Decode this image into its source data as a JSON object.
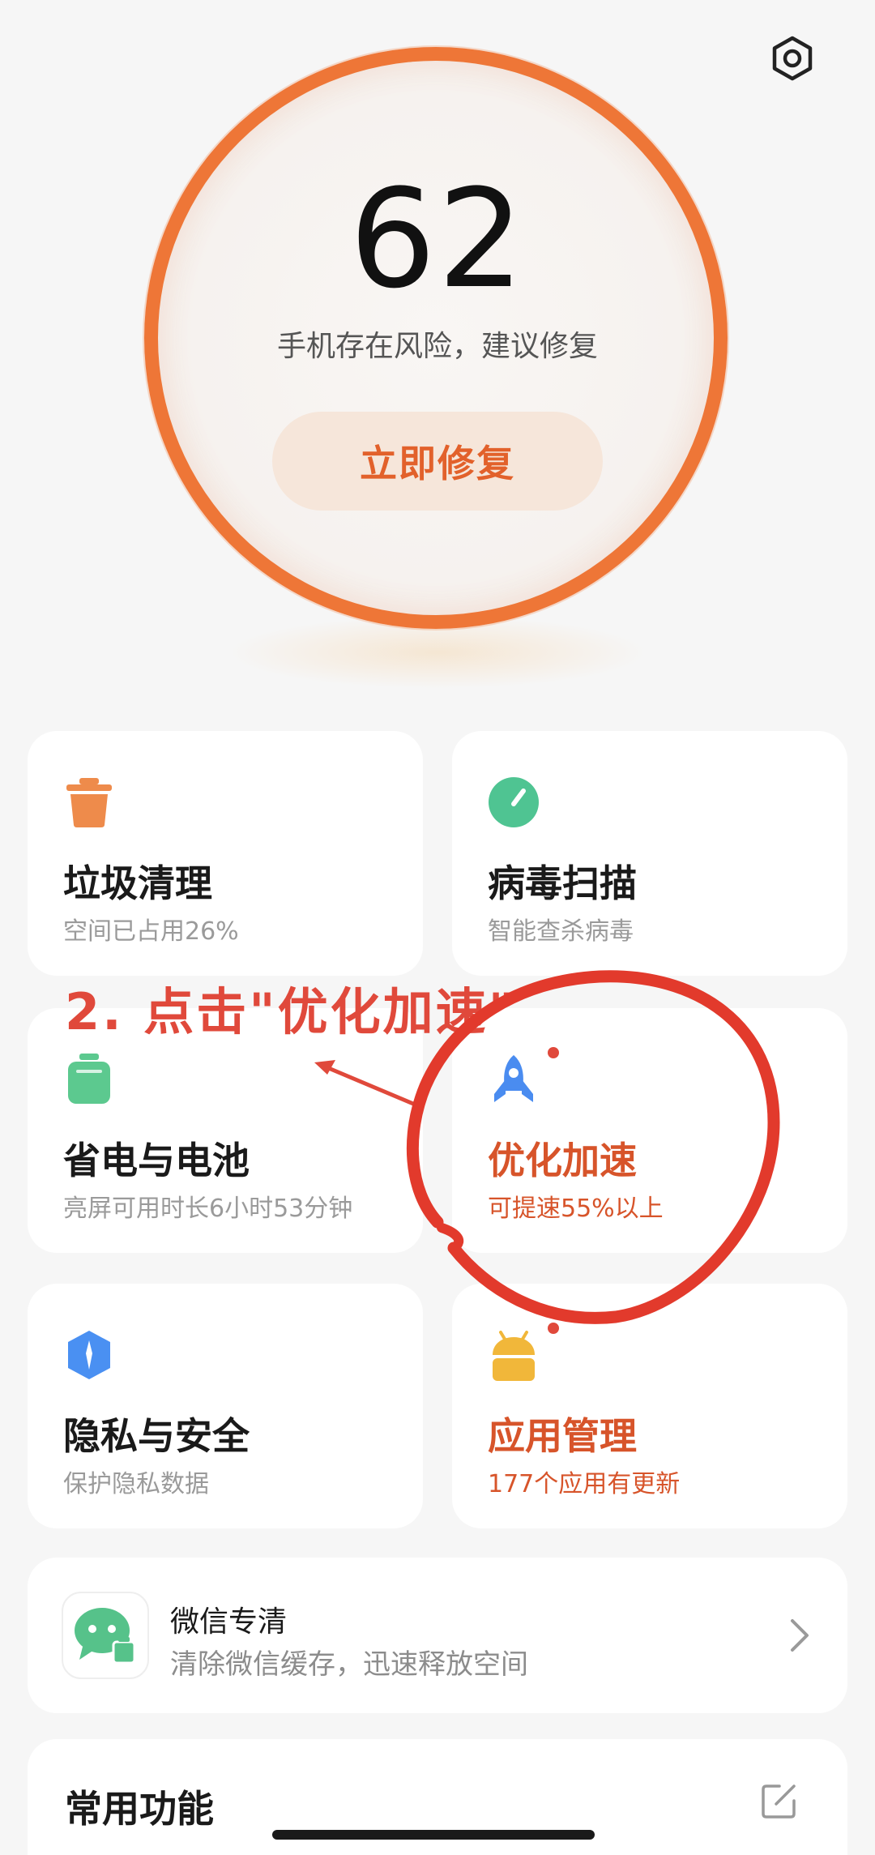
{
  "score": {
    "value": "62",
    "message": "手机存在风险，建议修复",
    "fix_label": "立即修复",
    "ring_color": "#ee7637"
  },
  "header": {
    "settings_icon": "settings-hex-icon"
  },
  "cards": [
    {
      "title": "垃圾清理",
      "subtitle": "空间已占用26%",
      "icon": "trash-icon",
      "color": "#ee8b4b"
    },
    {
      "title": "病毒扫描",
      "subtitle": "智能查杀病毒",
      "icon": "virus-scan-icon",
      "color": "#4fc492"
    },
    {
      "title": "省电与电池",
      "subtitle": "亮屏可用时长6小时53分钟",
      "icon": "battery-icon",
      "color": "#5cc98f"
    },
    {
      "title": "优化加速",
      "subtitle": "可提速55%以上",
      "icon": "rocket-icon",
      "color": "#4a8cf0",
      "alert": true
    },
    {
      "title": "隐私与安全",
      "subtitle": "保护隐私数据",
      "icon": "shield-privacy-icon",
      "color": "#4a90f2"
    },
    {
      "title": "应用管理",
      "subtitle": "177个应用有更新",
      "icon": "android-icon",
      "color": "#f1b73a",
      "alert": true
    }
  ],
  "wechat": {
    "title": "微信专清",
    "subtitle": "清除微信缓存，迅速释放空间",
    "icon": "wechat-clean-icon"
  },
  "common": {
    "title": "常用功能",
    "edit_icon": "edit-icon"
  },
  "annotation": {
    "text": "2. 点击\"优化加速\"",
    "color": "#e0493b"
  }
}
